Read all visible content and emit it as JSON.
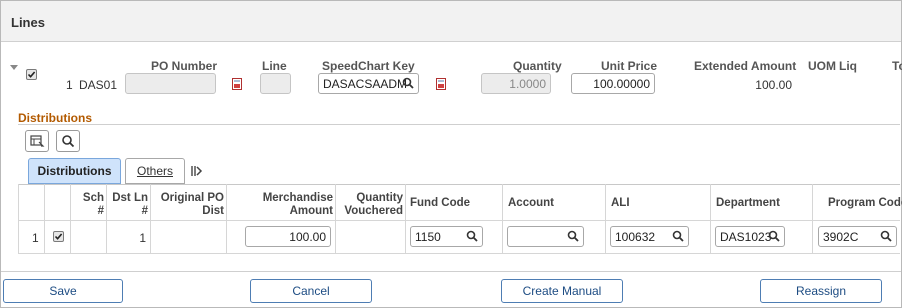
{
  "section": {
    "title": "Lines"
  },
  "line": {
    "number": "1",
    "business_unit": "DAS01",
    "headers": {
      "po_number": "PO Number",
      "line": "Line",
      "speedchart_key": "SpeedChart Key",
      "quantity": "Quantity",
      "unit_price": "Unit Price",
      "extended_amount": "Extended Amount",
      "uom": "UOM",
      "liq": "Liq",
      "to": "To"
    },
    "po_number_value": "",
    "line_value": "",
    "speedchart_value": "DASACSAADM",
    "quantity_value": "1.0000",
    "unit_price_value": "100.00000",
    "extended_amount_value": "100.00"
  },
  "distributions": {
    "title": "Distributions",
    "tabs": [
      {
        "label": "Distributions",
        "active": true
      },
      {
        "label": "Others",
        "active": false
      }
    ],
    "columns": {
      "sch": [
        "Sch",
        "#"
      ],
      "dst_ln": [
        "Dst Ln",
        "#"
      ],
      "orig_po": [
        "Original PO",
        "Dist"
      ],
      "merch": [
        "Merchandise",
        "Amount"
      ],
      "qty_vouchered": [
        "Quantity",
        "Vouchered"
      ],
      "fund_code": "Fund Code",
      "account": "Account",
      "ali": "ALI",
      "department": "Department",
      "program_code": "Program Code"
    },
    "rows": [
      {
        "row_num": "1",
        "dst_ln": "1",
        "merch_amount": "100.00",
        "fund_code": "1150",
        "account": "",
        "ali": "100632",
        "department": "DAS1023",
        "program_code": "3902C"
      }
    ]
  },
  "buttons": {
    "save": "Save",
    "cancel": "Cancel",
    "create_manual": "Create Manual",
    "reassign": "Reassign"
  },
  "colors": {
    "accent": "#b35a00",
    "button_text": "#1d4c83",
    "tab_active": "#cfe3fb"
  }
}
